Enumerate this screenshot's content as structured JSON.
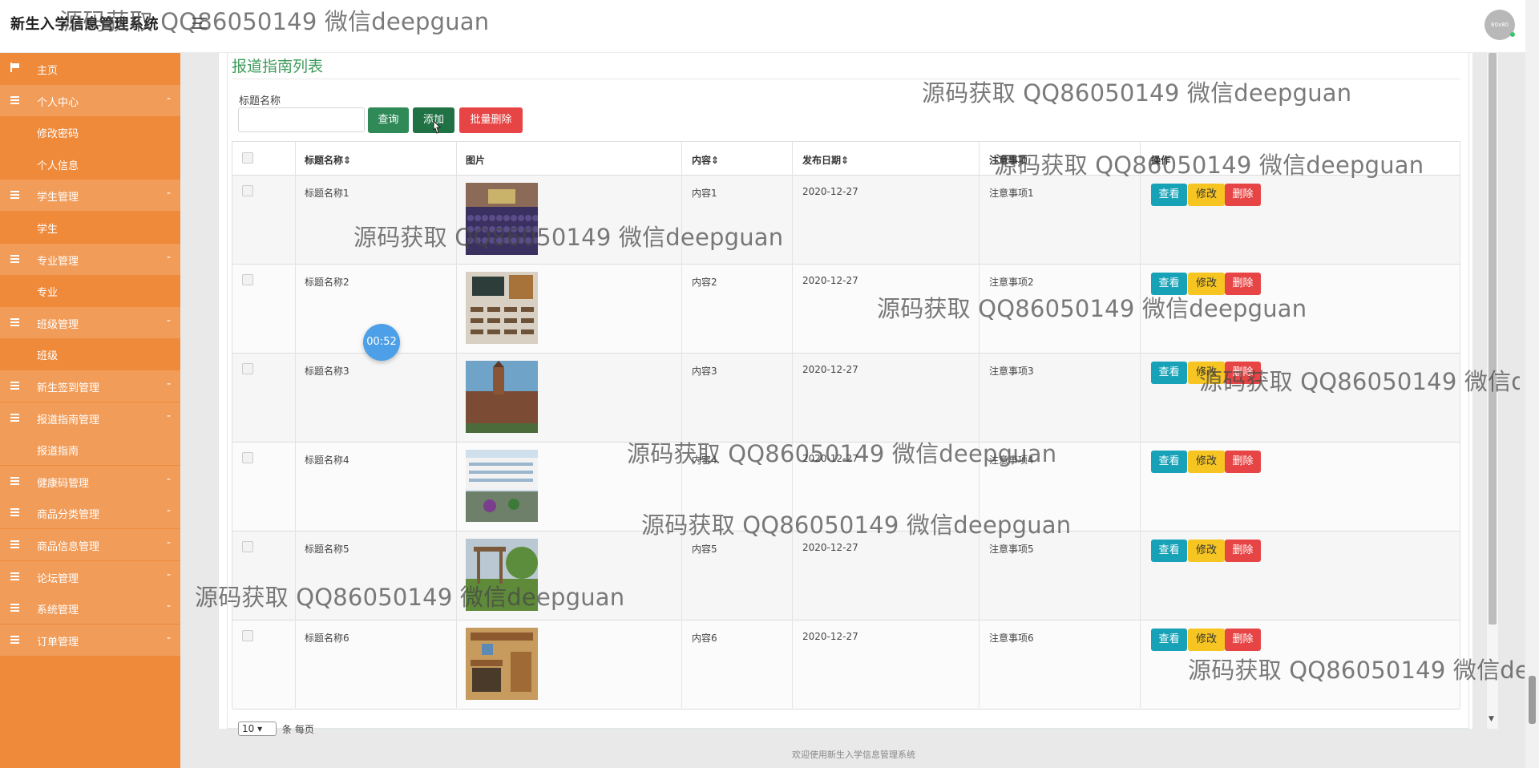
{
  "app": {
    "title": "新生入学信息管理系统",
    "avatar_text": "80x80"
  },
  "sidebar": {
    "items": [
      {
        "label": "主页",
        "type": "home"
      },
      {
        "label": "个人中心",
        "type": "group",
        "caret": "-"
      },
      {
        "label": "修改密码",
        "type": "sub"
      },
      {
        "label": "个人信息",
        "type": "sub"
      },
      {
        "label": "学生管理",
        "type": "group",
        "caret": "-"
      },
      {
        "label": "学生",
        "type": "sub"
      },
      {
        "label": "专业管理",
        "type": "group",
        "caret": "-"
      },
      {
        "label": "专业",
        "type": "sub"
      },
      {
        "label": "班级管理",
        "type": "group",
        "caret": "-"
      },
      {
        "label": "班级",
        "type": "sub"
      },
      {
        "label": "新生签到管理",
        "type": "group",
        "caret": "-"
      },
      {
        "label": "报道指南管理",
        "type": "group",
        "caret": "-"
      },
      {
        "label": "报道指南",
        "type": "sub",
        "active": true
      },
      {
        "label": "健康码管理",
        "type": "group",
        "caret": "-"
      },
      {
        "label": "商品分类管理",
        "type": "group",
        "caret": "-"
      },
      {
        "label": "商品信息管理",
        "type": "group",
        "caret": "-"
      },
      {
        "label": "论坛管理",
        "type": "group",
        "caret": "-"
      },
      {
        "label": "系统管理",
        "type": "group",
        "caret": "-"
      },
      {
        "label": "订单管理",
        "type": "group",
        "caret": "-"
      }
    ]
  },
  "main": {
    "section_title": "报道指南列表",
    "filter": {
      "label": "标题名称",
      "value": "",
      "placeholder": ""
    },
    "buttons": {
      "query": "查询",
      "add": "添加",
      "batch_delete": "批量删除"
    },
    "table": {
      "columns": [
        "标题名称",
        "图片",
        "内容",
        "发布日期",
        "注意事项",
        "操作"
      ],
      "sortable_marker": "⇕",
      "rows": [
        {
          "title": "标题名称1",
          "content": "内容1",
          "date": "2020-12-27",
          "notes": "注意事项1"
        },
        {
          "title": "标题名称2",
          "content": "内容2",
          "date": "2020-12-27",
          "notes": "注意事项2"
        },
        {
          "title": "标题名称3",
          "content": "内容3",
          "date": "2020-12-27",
          "notes": "注意事项3"
        },
        {
          "title": "标题名称4",
          "content": "内容4",
          "date": "2020-12-27",
          "notes": "注意事项4"
        },
        {
          "title": "标题名称5",
          "content": "内容5",
          "date": "2020-12-27",
          "notes": "注意事项5"
        },
        {
          "title": "标题名称6",
          "content": "内容6",
          "date": "2020-12-27",
          "notes": "注意事项6"
        }
      ],
      "actions": {
        "view": "查看",
        "edit": "修改",
        "delete": "删除"
      }
    },
    "pager": {
      "page_size": "10",
      "text": "条 每页"
    }
  },
  "footer": {
    "text": "欢迎使用新生入学信息管理系统"
  },
  "timer": {
    "text": "00:52"
  },
  "watermark": {
    "text": "源码获取 QQ86050149 微信deepguan"
  },
  "colors": {
    "sidebar": "#ef8a3b",
    "accent_green": "#3d9b5a",
    "danger": "#e74545",
    "info": "#17a2b8",
    "warning": "#f6c521"
  }
}
